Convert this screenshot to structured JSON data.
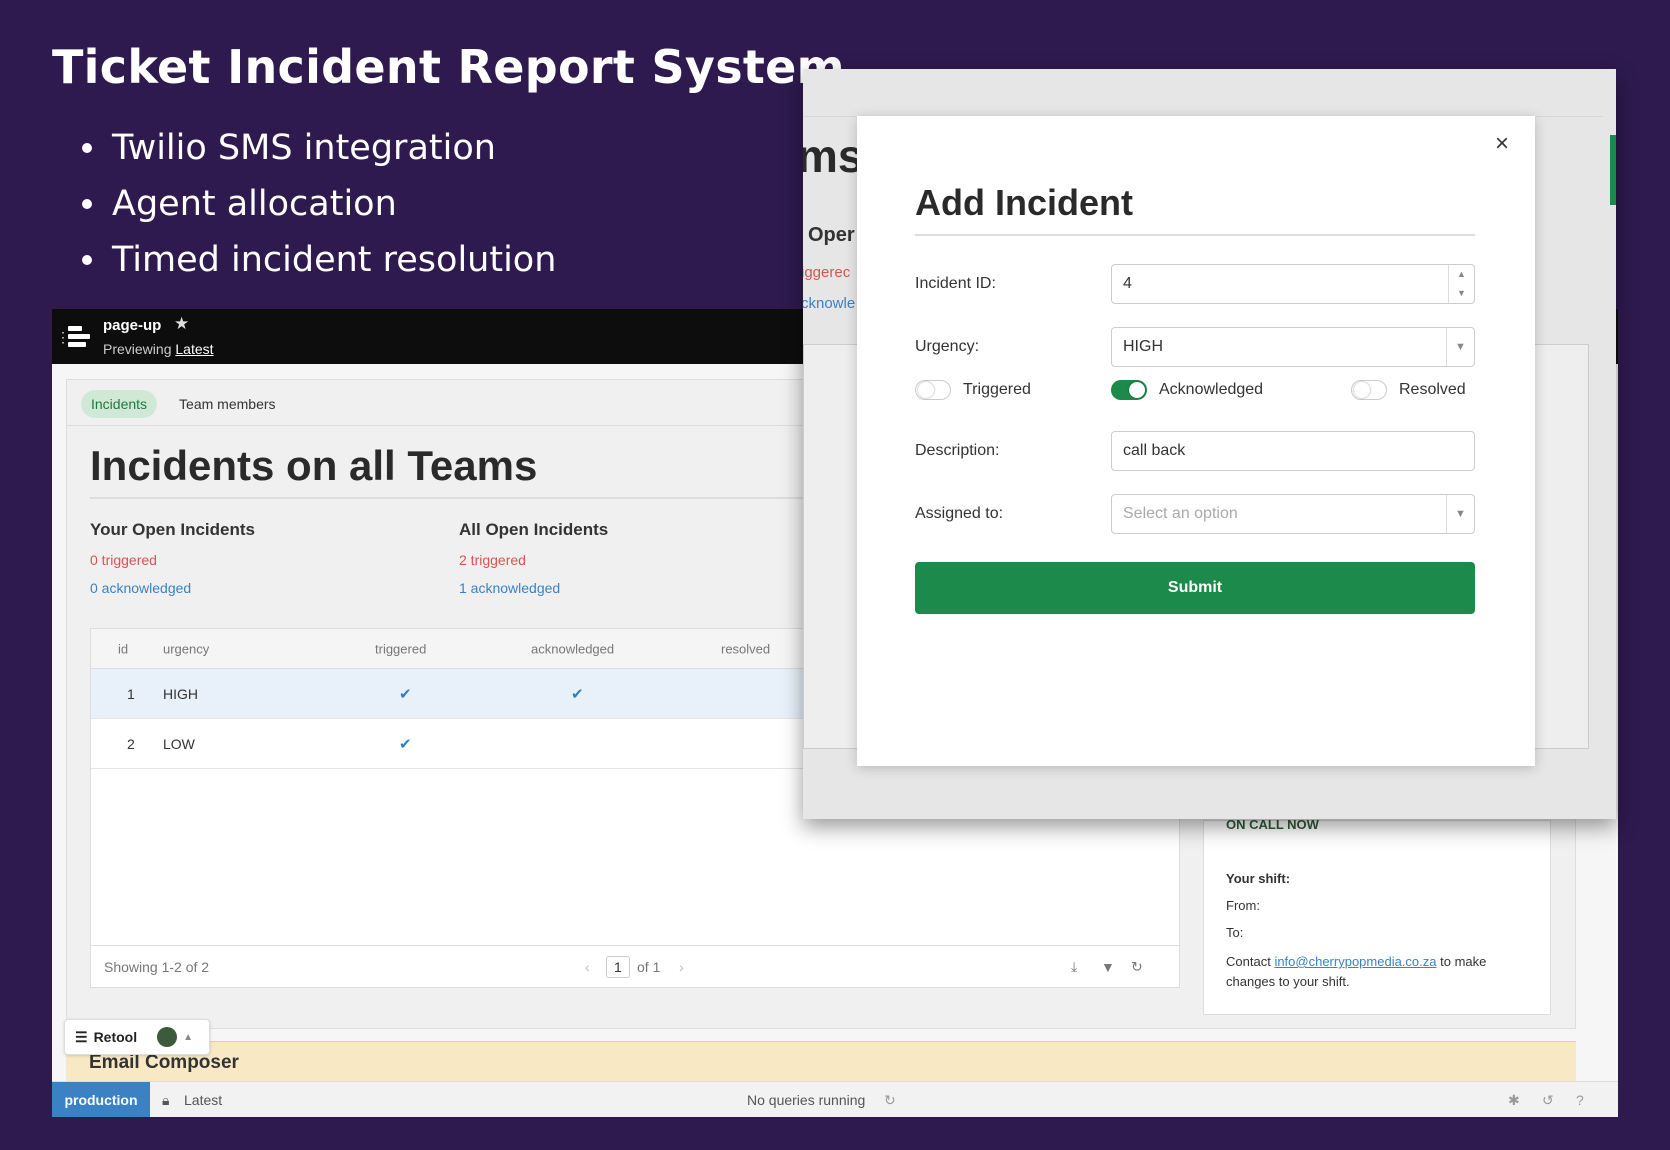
{
  "slide": {
    "title": "Ticket Incident Report System",
    "bullets": [
      "Twilio SMS integration",
      "Agent allocation",
      "Timed incident resolution"
    ]
  },
  "app": {
    "name": "page-up",
    "previewing_label": "Previewing",
    "version": "Latest",
    "tabs": [
      "Incidents",
      "Team members"
    ],
    "page_title": "Incidents on all Teams",
    "your_open": {
      "heading": "Your Open Incidents",
      "triggered": "0 triggered",
      "acknowledged": "0 acknowledged"
    },
    "all_open": {
      "heading": "All Open Incidents",
      "triggered": "2 triggered",
      "acknowledged": "1 acknowledged"
    },
    "table": {
      "columns": [
        "id",
        "urgency",
        "triggered",
        "acknowledged",
        "resolved"
      ],
      "rows": [
        {
          "id": "1",
          "urgency": "HIGH",
          "triggered": "✔",
          "acknowledged": "✔",
          "resolved": ""
        },
        {
          "id": "2",
          "urgency": "LOW",
          "triggered": "✔",
          "acknowledged": "",
          "resolved": ""
        }
      ],
      "footer": {
        "showing": "Showing 1-2 of 2",
        "page": "1",
        "of": "of 1"
      }
    },
    "oncall": {
      "header": "ON CALL NOW",
      "shift_label": "Your shift:",
      "from_label": "From:",
      "to_label": "To:",
      "contact_prefix": "Contact",
      "contact_email": "info@cherrypopmedia.co.za",
      "contact_suffix": "to make changes to your shift."
    },
    "email_composer": "Email Composer",
    "retool_badge": "Retool",
    "status": {
      "env": "production",
      "version": "Latest",
      "queries": "No queries running"
    }
  },
  "overlay": {
    "bg_title_fragment": "ms",
    "bg_open_fragment": "Oper",
    "bg_triggered_fragment": "iggerec",
    "bg_ack_fragment": "cknowle",
    "modal": {
      "close": "×",
      "title": "Add Incident",
      "incident_id_label": "Incident ID:",
      "incident_id_value": "4",
      "urgency_label": "Urgency:",
      "urgency_value": "HIGH",
      "toggles": [
        {
          "label": "Triggered",
          "on": false
        },
        {
          "label": "Acknowledged",
          "on": true
        },
        {
          "label": "Resolved",
          "on": false
        }
      ],
      "description_label": "Description:",
      "description_value": "call back",
      "assigned_label": "Assigned to:",
      "assigned_placeholder": "Select an option",
      "submit": "Submit"
    }
  },
  "colors": {
    "background": "#2e1a4f",
    "accent_green": "#1b8a4a",
    "link_blue": "#3a82c4",
    "triggered_red": "#d9534f"
  }
}
